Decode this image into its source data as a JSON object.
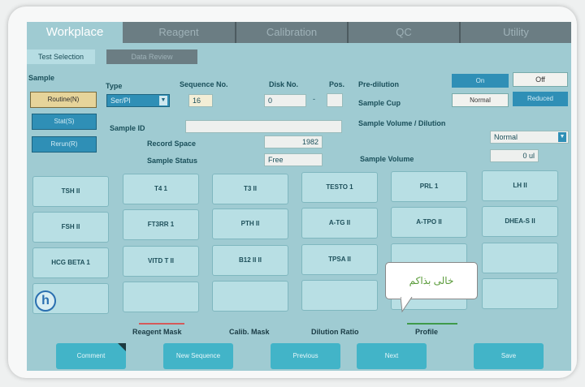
{
  "tabs": [
    "Workplace",
    "Reagent",
    "Calibration",
    "QC",
    "Utility"
  ],
  "subtabs": [
    "Test Selection",
    "Data Review"
  ],
  "sample": {
    "label": "Sample",
    "buttons": [
      "Routine(N)",
      "Stat(S)",
      "Rerun(R)"
    ]
  },
  "type": {
    "label": "Type",
    "value": "Ser/Pl"
  },
  "sequence": {
    "label": "Sequence No.",
    "value": "16"
  },
  "disk": {
    "label": "Disk No.",
    "value": "0",
    "sep": "-"
  },
  "pos": {
    "label": "Pos.",
    "value": ""
  },
  "predilution": {
    "label": "Pre-dilution",
    "on": "On",
    "off": "Off"
  },
  "sample_cup": {
    "label": "Sample Cup",
    "normal": "Normal",
    "reduced": "Reduced"
  },
  "sample_id": {
    "label": "Sample ID",
    "value": ""
  },
  "volume_dilution": {
    "label": "Sample Volume / Dilution",
    "value": "Normal"
  },
  "record_space": {
    "label": "Record Space",
    "value": "1982"
  },
  "sample_status": {
    "label": "Sample Status",
    "value": "Free"
  },
  "sample_volume": {
    "label": "Sample Volume",
    "value": "0",
    "unit": "ul"
  },
  "tests": [
    [
      "TSH II",
      "T4 1",
      "T3 II",
      "TESTO 1",
      "PRL 1",
      "LH II"
    ],
    [
      "FSH II",
      "FT3RR 1",
      "PTH II",
      "A-TG II",
      "A-TPO II",
      "DHEA-S II"
    ],
    [
      "HCG BETA 1",
      "VITD T II",
      "B12 II II",
      "TPSA II",
      "",
      ""
    ],
    [
      "",
      "",
      "",
      "",
      "",
      ""
    ]
  ],
  "tooltip": "خالی بذاکم",
  "help_icon": "h",
  "legend": [
    "Reagent Mask",
    "Calib. Mask",
    "Dilution Ratio",
    "Profile"
  ],
  "footer": [
    "Comment",
    "New Sequence",
    "Previous",
    "Next",
    "Save"
  ]
}
